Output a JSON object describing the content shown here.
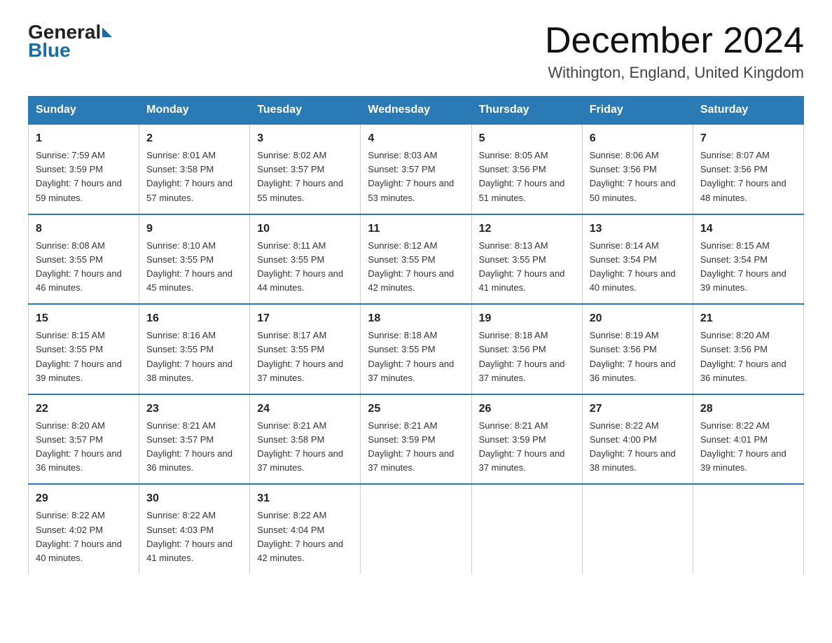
{
  "logo": {
    "general": "General",
    "blue": "Blue",
    "arrow_shape": "triangle"
  },
  "header": {
    "month_title": "December 2024",
    "location": "Withington, England, United Kingdom"
  },
  "days_of_week": [
    "Sunday",
    "Monday",
    "Tuesday",
    "Wednesday",
    "Thursday",
    "Friday",
    "Saturday"
  ],
  "weeks": [
    [
      {
        "day": "1",
        "sunrise": "7:59 AM",
        "sunset": "3:59 PM",
        "daylight": "7 hours and 59 minutes."
      },
      {
        "day": "2",
        "sunrise": "8:01 AM",
        "sunset": "3:58 PM",
        "daylight": "7 hours and 57 minutes."
      },
      {
        "day": "3",
        "sunrise": "8:02 AM",
        "sunset": "3:57 PM",
        "daylight": "7 hours and 55 minutes."
      },
      {
        "day": "4",
        "sunrise": "8:03 AM",
        "sunset": "3:57 PM",
        "daylight": "7 hours and 53 minutes."
      },
      {
        "day": "5",
        "sunrise": "8:05 AM",
        "sunset": "3:56 PM",
        "daylight": "7 hours and 51 minutes."
      },
      {
        "day": "6",
        "sunrise": "8:06 AM",
        "sunset": "3:56 PM",
        "daylight": "7 hours and 50 minutes."
      },
      {
        "day": "7",
        "sunrise": "8:07 AM",
        "sunset": "3:56 PM",
        "daylight": "7 hours and 48 minutes."
      }
    ],
    [
      {
        "day": "8",
        "sunrise": "8:08 AM",
        "sunset": "3:55 PM",
        "daylight": "7 hours and 46 minutes."
      },
      {
        "day": "9",
        "sunrise": "8:10 AM",
        "sunset": "3:55 PM",
        "daylight": "7 hours and 45 minutes."
      },
      {
        "day": "10",
        "sunrise": "8:11 AM",
        "sunset": "3:55 PM",
        "daylight": "7 hours and 44 minutes."
      },
      {
        "day": "11",
        "sunrise": "8:12 AM",
        "sunset": "3:55 PM",
        "daylight": "7 hours and 42 minutes."
      },
      {
        "day": "12",
        "sunrise": "8:13 AM",
        "sunset": "3:55 PM",
        "daylight": "7 hours and 41 minutes."
      },
      {
        "day": "13",
        "sunrise": "8:14 AM",
        "sunset": "3:54 PM",
        "daylight": "7 hours and 40 minutes."
      },
      {
        "day": "14",
        "sunrise": "8:15 AM",
        "sunset": "3:54 PM",
        "daylight": "7 hours and 39 minutes."
      }
    ],
    [
      {
        "day": "15",
        "sunrise": "8:15 AM",
        "sunset": "3:55 PM",
        "daylight": "7 hours and 39 minutes."
      },
      {
        "day": "16",
        "sunrise": "8:16 AM",
        "sunset": "3:55 PM",
        "daylight": "7 hours and 38 minutes."
      },
      {
        "day": "17",
        "sunrise": "8:17 AM",
        "sunset": "3:55 PM",
        "daylight": "7 hours and 37 minutes."
      },
      {
        "day": "18",
        "sunrise": "8:18 AM",
        "sunset": "3:55 PM",
        "daylight": "7 hours and 37 minutes."
      },
      {
        "day": "19",
        "sunrise": "8:18 AM",
        "sunset": "3:56 PM",
        "daylight": "7 hours and 37 minutes."
      },
      {
        "day": "20",
        "sunrise": "8:19 AM",
        "sunset": "3:56 PM",
        "daylight": "7 hours and 36 minutes."
      },
      {
        "day": "21",
        "sunrise": "8:20 AM",
        "sunset": "3:56 PM",
        "daylight": "7 hours and 36 minutes."
      }
    ],
    [
      {
        "day": "22",
        "sunrise": "8:20 AM",
        "sunset": "3:57 PM",
        "daylight": "7 hours and 36 minutes."
      },
      {
        "day": "23",
        "sunrise": "8:21 AM",
        "sunset": "3:57 PM",
        "daylight": "7 hours and 36 minutes."
      },
      {
        "day": "24",
        "sunrise": "8:21 AM",
        "sunset": "3:58 PM",
        "daylight": "7 hours and 37 minutes."
      },
      {
        "day": "25",
        "sunrise": "8:21 AM",
        "sunset": "3:59 PM",
        "daylight": "7 hours and 37 minutes."
      },
      {
        "day": "26",
        "sunrise": "8:21 AM",
        "sunset": "3:59 PM",
        "daylight": "7 hours and 37 minutes."
      },
      {
        "day": "27",
        "sunrise": "8:22 AM",
        "sunset": "4:00 PM",
        "daylight": "7 hours and 38 minutes."
      },
      {
        "day": "28",
        "sunrise": "8:22 AM",
        "sunset": "4:01 PM",
        "daylight": "7 hours and 39 minutes."
      }
    ],
    [
      {
        "day": "29",
        "sunrise": "8:22 AM",
        "sunset": "4:02 PM",
        "daylight": "7 hours and 40 minutes."
      },
      {
        "day": "30",
        "sunrise": "8:22 AM",
        "sunset": "4:03 PM",
        "daylight": "7 hours and 41 minutes."
      },
      {
        "day": "31",
        "sunrise": "8:22 AM",
        "sunset": "4:04 PM",
        "daylight": "7 hours and 42 minutes."
      },
      null,
      null,
      null,
      null
    ]
  ]
}
